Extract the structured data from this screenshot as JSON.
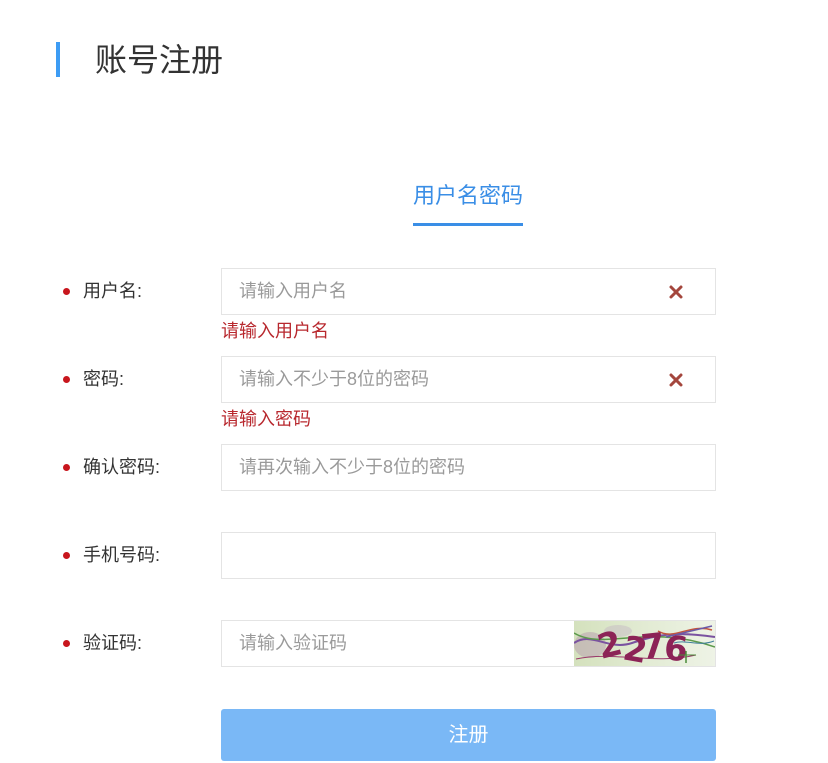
{
  "header": {
    "title": "账号注册"
  },
  "tabs": [
    {
      "label": "用户名密码",
      "active": true
    }
  ],
  "form": {
    "username": {
      "label": "用户名:",
      "placeholder": "请输入用户名",
      "value": "",
      "required": true,
      "error": "请输入用户名",
      "clear_icon": "close-x-icon"
    },
    "password": {
      "label": "密码:",
      "placeholder": "请输入不少于8位的密码",
      "value": "",
      "required": true,
      "error": "请输入密码",
      "clear_icon": "close-x-icon"
    },
    "confirm_password": {
      "label": "确认密码:",
      "placeholder": "请再次输入不少于8位的密码",
      "value": "",
      "required": true
    },
    "phone": {
      "label": "手机号码:",
      "value": "",
      "required": true
    },
    "captcha": {
      "label": "验证码:",
      "placeholder": "请输入验证码",
      "value": "",
      "required": true,
      "image_code": "2276"
    },
    "submit_label": "注册"
  },
  "colors": {
    "accent": "#3d9cf4",
    "tab_active": "#3a8ee6",
    "required_dot": "#c8161d",
    "error": "#b8282e",
    "clear_icon": "#a4463d",
    "button_bg": "#7ab8f6"
  }
}
